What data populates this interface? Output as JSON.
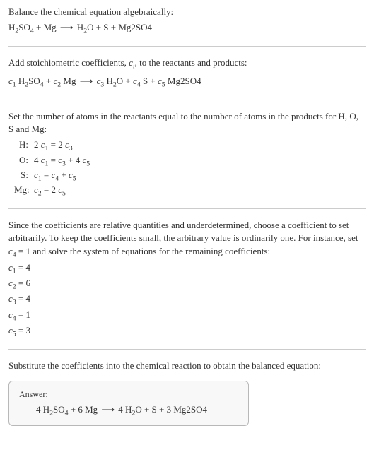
{
  "intro": {
    "line1": "Balance the chemical equation algebraically:",
    "eq_left_1": "H",
    "eq_left_2": "SO",
    "eq_left_3": " + Mg ",
    "eq_right_1": " H",
    "eq_right_2": "O + S + Mg2SO4"
  },
  "step1": {
    "line1_a": "Add stoichiometric coefficients, ",
    "line1_c": "c",
    "line1_i": "i",
    "line1_b": ", to the reactants and products:",
    "c1": "c",
    "n1": "1",
    "t1": " H",
    "s2": "2",
    "t2": "SO",
    "s4": "4",
    "t3": " + ",
    "c2": "c",
    "n2": "2",
    "t4": " Mg ",
    "c3": "c",
    "n3": "3",
    "t5": " H",
    "t6": "O + ",
    "c4": "c",
    "n4": "4",
    "t7": " S + ",
    "c5": "c",
    "n5": "5",
    "t8": " Mg2SO4"
  },
  "step2": {
    "intro": "Set the number of atoms in the reactants equal to the number of atoms in the products for H, O, S and Mg:",
    "rows": [
      {
        "label": "H:",
        "lhs_a": "2 ",
        "lhs_c": "c",
        "lhs_n": "1",
        "eq": " = 2 ",
        "rhs_c": "c",
        "rhs_n": "3",
        "extra": ""
      },
      {
        "label": "O:",
        "lhs_a": "4 ",
        "lhs_c": "c",
        "lhs_n": "1",
        "eq": " = ",
        "rhs_c": "c",
        "rhs_n": "3",
        "extra_a": " + 4 ",
        "extra_c": "c",
        "extra_n": "5"
      },
      {
        "label": "S:",
        "lhs_a": "",
        "lhs_c": "c",
        "lhs_n": "1",
        "eq": " = ",
        "rhs_c": "c",
        "rhs_n": "4",
        "extra_a": " + ",
        "extra_c": "c",
        "extra_n": "5"
      },
      {
        "label": "Mg:",
        "lhs_a": "",
        "lhs_c": "c",
        "lhs_n": "2",
        "eq": " = 2 ",
        "rhs_c": "c",
        "rhs_n": "5",
        "extra": ""
      }
    ]
  },
  "step3": {
    "intro_a": "Since the coefficients are relative quantities and underdetermined, choose a coefficient to set arbitrarily. To keep the coefficients small, the arbitrary value is ordinarily one. For instance, set ",
    "intro_c": "c",
    "intro_n": "4",
    "intro_b": " = 1 and solve the system of equations for the remaining coefficients:",
    "sols": [
      {
        "c": "c",
        "n": "1",
        "v": " = 4"
      },
      {
        "c": "c",
        "n": "2",
        "v": " = 6"
      },
      {
        "c": "c",
        "n": "3",
        "v": " = 4"
      },
      {
        "c": "c",
        "n": "4",
        "v": " = 1"
      },
      {
        "c": "c",
        "n": "5",
        "v": " = 3"
      }
    ]
  },
  "step4": {
    "intro": "Substitute the coefficients into the chemical reaction to obtain the balanced equation:"
  },
  "answer": {
    "label": "Answer:",
    "t1": "4 H",
    "s2": "2",
    "t2": "SO",
    "s4": "4",
    "t3": " + 6 Mg ",
    "t4": " 4 H",
    "t5": "O + S + 3 Mg2SO4"
  },
  "arrow": "⟶",
  "chart_data": {
    "type": "table",
    "title": "Balanced chemical equation coefficients",
    "reaction": "4 H2SO4 + 6 Mg -> 4 H2O + S + 3 Mg2SO4",
    "atom_balance": [
      {
        "element": "H",
        "equation": "2 c1 = 2 c3"
      },
      {
        "element": "O",
        "equation": "4 c1 = c3 + 4 c5"
      },
      {
        "element": "S",
        "equation": "c1 = c4 + c5"
      },
      {
        "element": "Mg",
        "equation": "c2 = 2 c5"
      }
    ],
    "coefficients": {
      "c1": 4,
      "c2": 6,
      "c3": 4,
      "c4": 1,
      "c5": 3
    }
  }
}
